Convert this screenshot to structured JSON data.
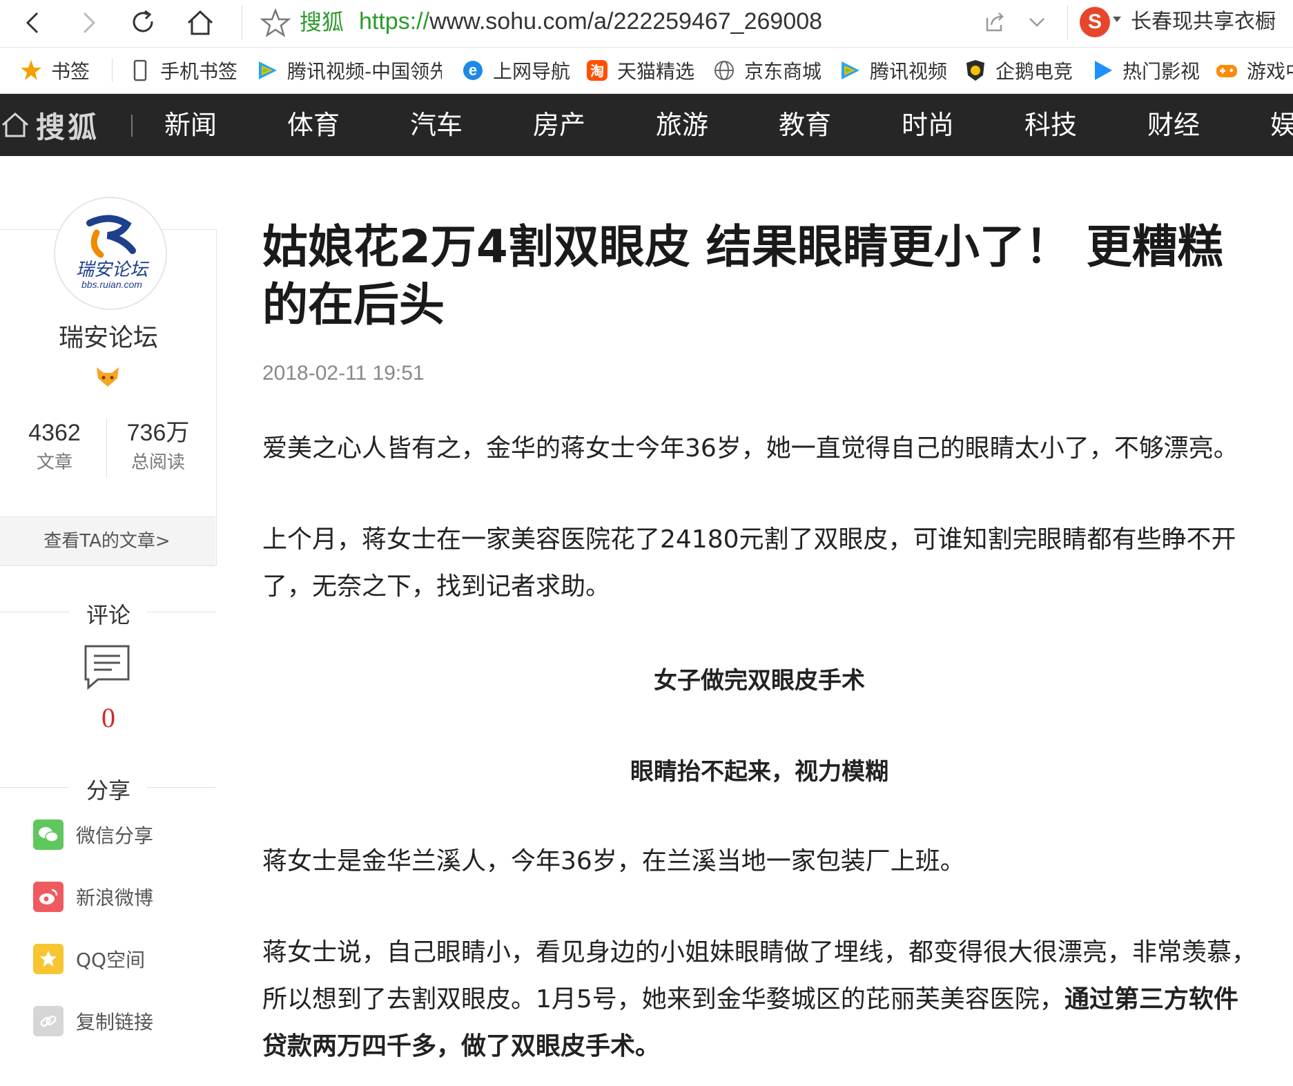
{
  "browser": {
    "site_name": "搜狐",
    "url_protocol": "https://",
    "url_rest": "www.sohu.com/a/222259467_269008",
    "search_hint": "长春现共享衣橱",
    "search_engine_letter": "S"
  },
  "bookmarks": [
    {
      "label": "书签",
      "icon": "star-icon"
    },
    {
      "label": "手机书签",
      "icon": "phone-icon"
    },
    {
      "label": "腾讯视频-中国领先",
      "icon": "tencent-video-icon"
    },
    {
      "label": "上网导航",
      "icon": "ie-icon"
    },
    {
      "label": "天猫精选",
      "icon": "tmall-icon"
    },
    {
      "label": "京东商城",
      "icon": "globe-icon"
    },
    {
      "label": "腾讯视频",
      "icon": "tencent-video-icon"
    },
    {
      "label": "企鹅电竞",
      "icon": "penguin-icon"
    },
    {
      "label": "热门影视",
      "icon": "play-icon"
    },
    {
      "label": "游戏中",
      "icon": "game-icon"
    }
  ],
  "nav": {
    "logo": "搜狐",
    "items": [
      "新闻",
      "体育",
      "汽车",
      "房产",
      "旅游",
      "教育",
      "时尚",
      "科技",
      "财经",
      "娱"
    ]
  },
  "author": {
    "avatar_text": "瑞安论坛",
    "avatar_sub": "bbs.ruian.com",
    "name": "瑞安论坛",
    "articles_count": "4362",
    "articles_label": "文章",
    "reads_count": "736万",
    "reads_label": "总阅读",
    "view_articles": "查看TA的文章>"
  },
  "comments": {
    "title": "评论",
    "count": "0"
  },
  "share": {
    "title": "分享",
    "items": [
      {
        "label": "微信分享",
        "color": "#5fc85c"
      },
      {
        "label": "新浪微博",
        "color": "#ef5a5e"
      },
      {
        "label": "QQ空间",
        "color": "#f7c531"
      },
      {
        "label": "复制链接",
        "color": "#d6d6d6"
      }
    ]
  },
  "article": {
    "title": "姑娘花2万4割双眼皮 结果眼睛更小了！ 更糟糕的在后头",
    "date": "2018-02-11 19:51",
    "p1": "爱美之心人皆有之，金华的蒋女士今年36岁，她一直觉得自己的眼睛太小了，不够漂亮。",
    "p2": "上个月，蒋女士在一家美容医院花了24180元割了双眼皮，可谁知割完眼睛都有些睁不开了，无奈之下，找到记者求助。",
    "caption1": "女子做完双眼皮手术",
    "caption2": "眼睛抬不起来，视力模糊",
    "p3": "蒋女士是金华兰溪人，今年36岁，在兰溪当地一家包装厂上班。",
    "p4_normal": "蒋女士说，自己眼睛小，看见身边的小姐妹眼睛做了埋线，都变得很大很漂亮，非常羡慕，所以想到了去割双眼皮。1月5号，她来到金华婺城区的芘丽芙美容医院，",
    "p4_bold": "通过第三方软件贷款两万四千多，做了双眼皮手术。"
  }
}
